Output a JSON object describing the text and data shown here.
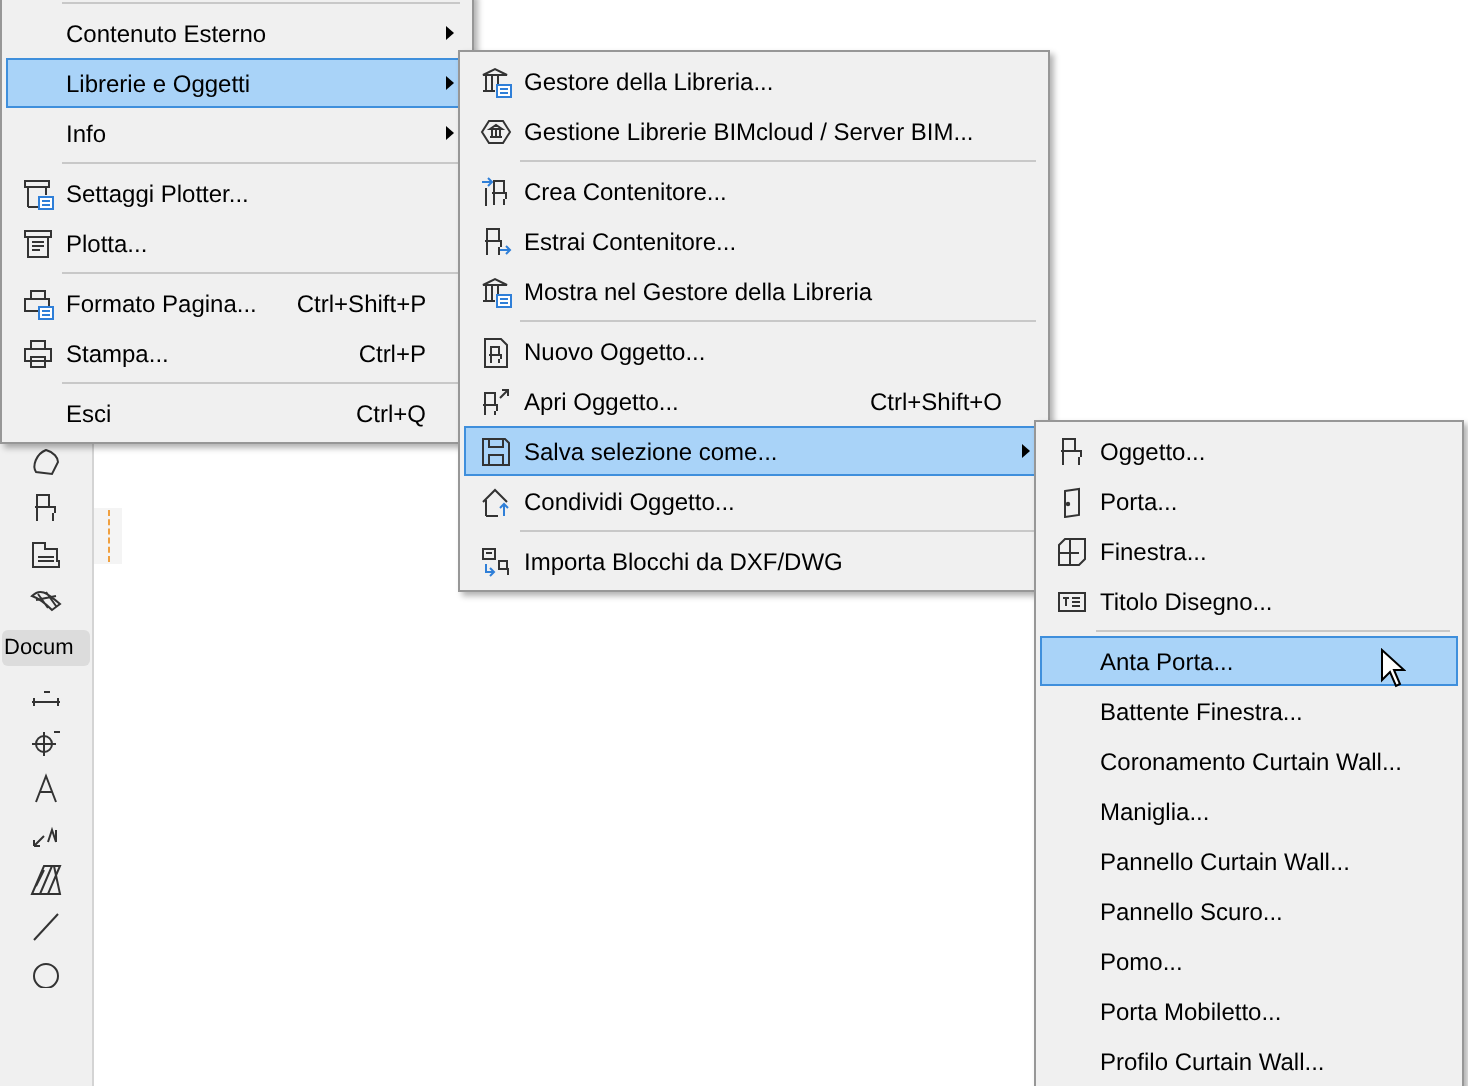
{
  "toolbar": {
    "section_label": "Docum"
  },
  "menus": [
    {
      "items": [
        {
          "kind": "separator"
        },
        {
          "kind": "item",
          "label": "Contenuto Esterno",
          "has_submenu": true,
          "selected": false
        },
        {
          "kind": "item",
          "label": "Librerie e Oggetti",
          "has_submenu": true,
          "selected": true
        },
        {
          "kind": "item",
          "label": "Info",
          "has_submenu": true,
          "selected": false
        },
        {
          "kind": "separator"
        },
        {
          "kind": "item",
          "label": "Settaggi Plotter...",
          "has_submenu": false,
          "selected": false
        },
        {
          "kind": "item",
          "label": "Plotta...",
          "has_submenu": false,
          "selected": false
        },
        {
          "kind": "separator"
        },
        {
          "kind": "item",
          "label": "Formato Pagina...",
          "shortcut": "Ctrl+Shift+P",
          "has_submenu": false,
          "selected": false
        },
        {
          "kind": "item",
          "label": "Stampa...",
          "shortcut": "Ctrl+P",
          "has_submenu": false,
          "selected": false
        },
        {
          "kind": "separator"
        },
        {
          "kind": "item",
          "label": "Esci",
          "shortcut": "Ctrl+Q",
          "has_submenu": false,
          "selected": false
        }
      ]
    },
    {
      "items": [
        {
          "kind": "item",
          "label": "Gestore della Libreria...",
          "has_submenu": false,
          "selected": false
        },
        {
          "kind": "item",
          "label": "Gestione Librerie BIMcloud / Server BIM...",
          "has_submenu": false,
          "selected": false
        },
        {
          "kind": "separator"
        },
        {
          "kind": "item",
          "label": "Crea Contenitore...",
          "has_submenu": false,
          "selected": false
        },
        {
          "kind": "item",
          "label": "Estrai Contenitore...",
          "has_submenu": false,
          "selected": false
        },
        {
          "kind": "item",
          "label": "Mostra nel Gestore della Libreria",
          "has_submenu": false,
          "selected": false
        },
        {
          "kind": "separator"
        },
        {
          "kind": "item",
          "label": "Nuovo Oggetto...",
          "has_submenu": false,
          "selected": false
        },
        {
          "kind": "item",
          "label": "Apri Oggetto...",
          "shortcut": "Ctrl+Shift+O",
          "has_submenu": false,
          "selected": false
        },
        {
          "kind": "item",
          "label": "Salva selezione come...",
          "has_submenu": true,
          "selected": true
        },
        {
          "kind": "item",
          "label": "Condividi Oggetto...",
          "has_submenu": false,
          "selected": false
        },
        {
          "kind": "separator"
        },
        {
          "kind": "item",
          "label": "Importa Blocchi da DXF/DWG",
          "has_submenu": false,
          "selected": false
        }
      ]
    },
    {
      "items": [
        {
          "kind": "item",
          "label": "Oggetto...",
          "has_submenu": false,
          "selected": false
        },
        {
          "kind": "item",
          "label": "Porta...",
          "has_submenu": false,
          "selected": false
        },
        {
          "kind": "item",
          "label": "Finestra...",
          "has_submenu": false,
          "selected": false
        },
        {
          "kind": "item",
          "label": "Titolo Disegno...",
          "has_submenu": false,
          "selected": false
        },
        {
          "kind": "separator"
        },
        {
          "kind": "item",
          "label": "Anta Porta...",
          "has_submenu": false,
          "selected": true
        },
        {
          "kind": "item",
          "label": "Battente Finestra...",
          "has_submenu": false,
          "selected": false
        },
        {
          "kind": "item",
          "label": "Coronamento Curtain Wall...",
          "has_submenu": false,
          "selected": false
        },
        {
          "kind": "item",
          "label": "Maniglia...",
          "has_submenu": false,
          "selected": false
        },
        {
          "kind": "item",
          "label": "Pannello Curtain Wall...",
          "has_submenu": false,
          "selected": false
        },
        {
          "kind": "item",
          "label": "Pannello Scuro...",
          "has_submenu": false,
          "selected": false
        },
        {
          "kind": "item",
          "label": "Pomo...",
          "has_submenu": false,
          "selected": false
        },
        {
          "kind": "item",
          "label": "Porta Mobiletto...",
          "has_submenu": false,
          "selected": false
        },
        {
          "kind": "item",
          "label": "Profilo Curtain Wall...",
          "has_submenu": false,
          "selected": false
        }
      ]
    }
  ]
}
